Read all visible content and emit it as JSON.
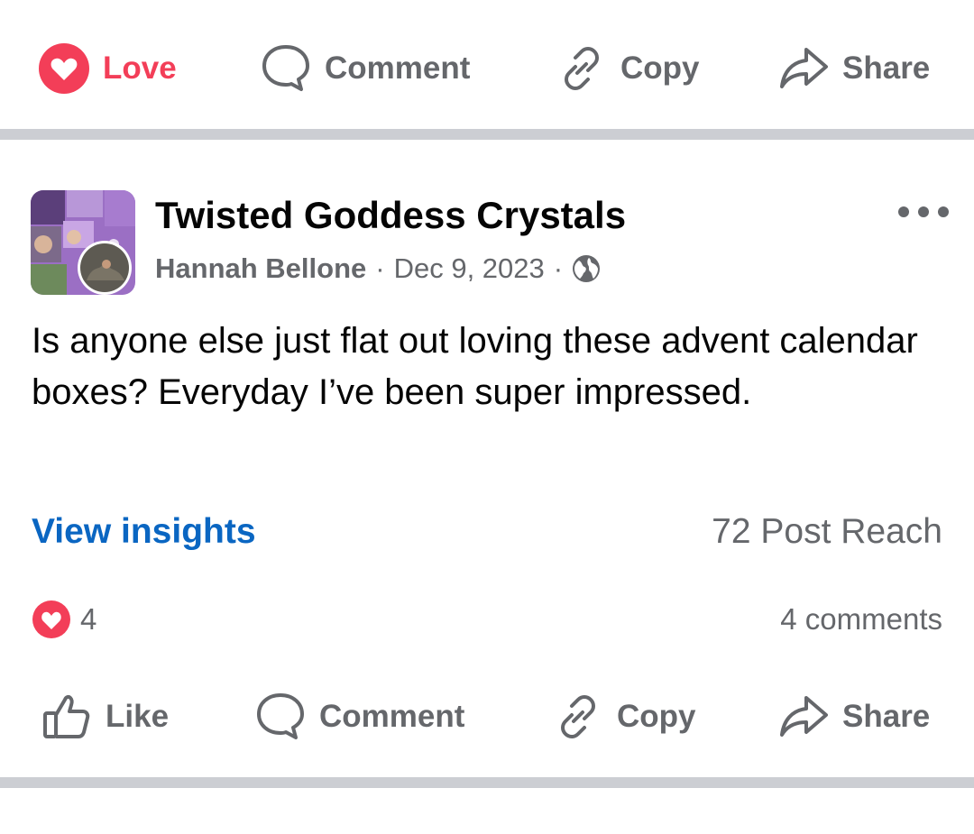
{
  "top_actions": {
    "love": "Love",
    "comment": "Comment",
    "copy": "Copy",
    "share": "Share"
  },
  "post": {
    "page_name": "Twisted Goddess Crystals",
    "author": "Hannah Bellone",
    "separator": "·",
    "date": "Dec 9, 2023",
    "audience_icon": "globe-icon",
    "text": "Is anyone else just flat out loving these advent calendar boxes? Everyday I’ve been super impressed.",
    "insights_link": "View insights",
    "reach": "72 Post Reach",
    "reaction_count": "4",
    "comments_count": "4 comments"
  },
  "bottom_actions": {
    "like": "Like",
    "comment": "Comment",
    "copy": "Copy",
    "share": "Share"
  },
  "colors": {
    "love": "#f33e58",
    "link": "#0a66c2",
    "muted": "#65676b",
    "divider": "#ccced3"
  }
}
